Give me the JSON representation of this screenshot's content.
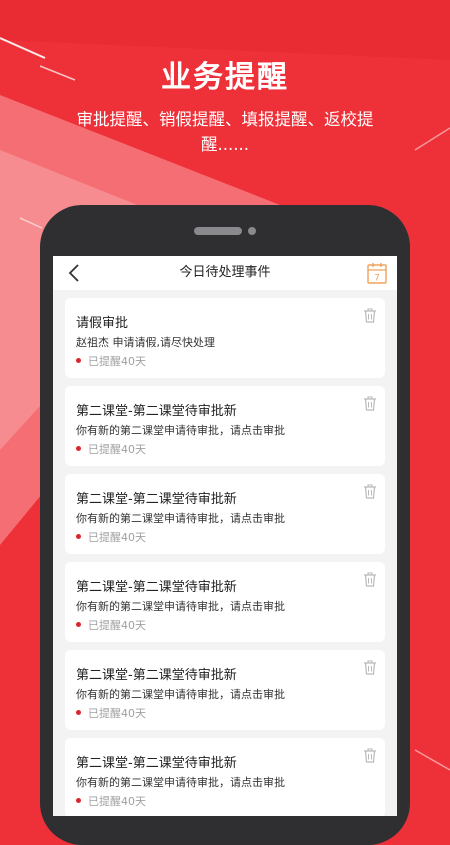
{
  "promo": {
    "title": "业务提醒",
    "subtitle": "审批提醒、销假提醒、填报提醒、返校提醒......"
  },
  "header": {
    "title": "今日待处理事件",
    "back_icon": "chevron-left-icon",
    "calendar_icon": "calendar-icon",
    "calendar_day": "7"
  },
  "colors": {
    "brand_red": "#ee3139",
    "status_dot": "#d9262c",
    "calendar_accent": "#f0a35a"
  },
  "events": [
    {
      "title": "请假审批",
      "desc": "赵祖杰 申请请假,请尽快处理",
      "status": "已提醒40天"
    },
    {
      "title": "第二课堂-第二课堂待审批新",
      "desc": "你有新的第二课堂申请待审批，请点击审批",
      "status": "已提醒40天"
    },
    {
      "title": "第二课堂-第二课堂待审批新",
      "desc": "你有新的第二课堂申请待审批，请点击审批",
      "status": "已提醒40天"
    },
    {
      "title": "第二课堂-第二课堂待审批新",
      "desc": "你有新的第二课堂申请待审批，请点击审批",
      "status": "已提醒40天"
    },
    {
      "title": "第二课堂-第二课堂待审批新",
      "desc": "你有新的第二课堂申请待审批，请点击审批",
      "status": "已提醒40天"
    },
    {
      "title": "第二课堂-第二课堂待审批新",
      "desc": "你有新的第二课堂申请待审批，请点击审批",
      "status": "已提醒40天"
    }
  ]
}
